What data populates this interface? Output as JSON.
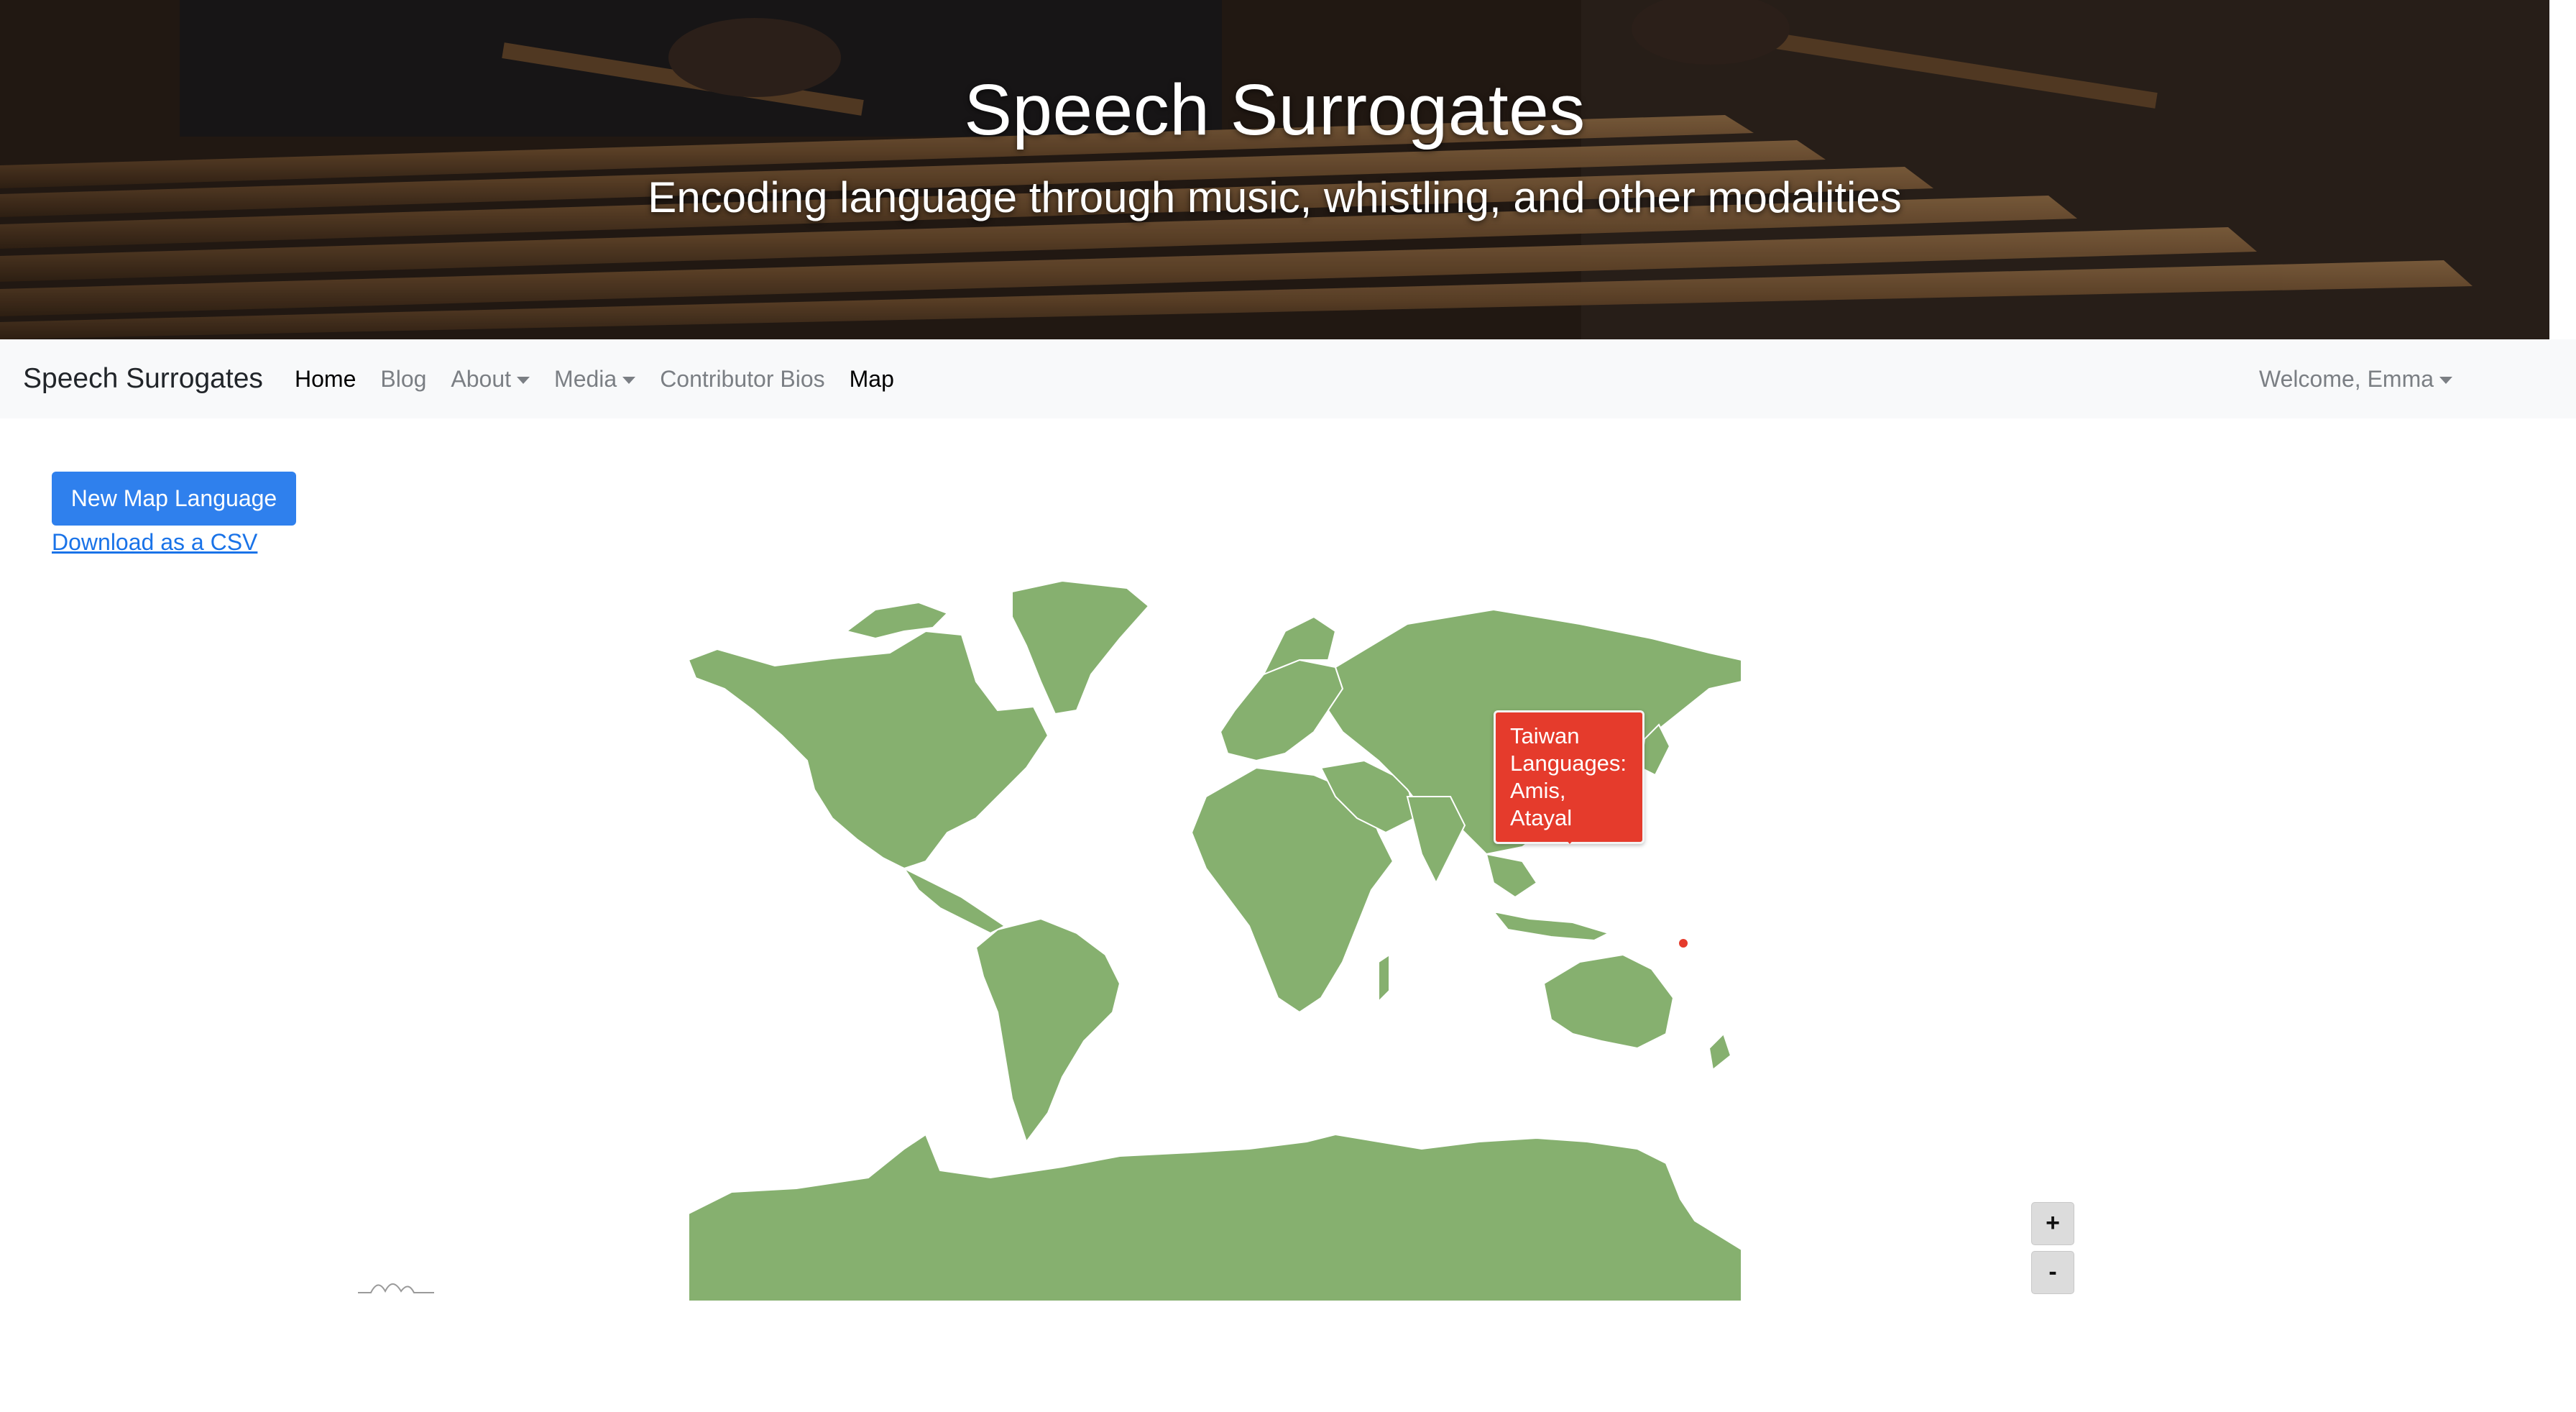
{
  "hero": {
    "title": "Speech Surrogates",
    "subtitle": "Encoding language through music, whistling, and other modalities"
  },
  "navbar": {
    "brand": "Speech Surrogates",
    "links": [
      {
        "label": "Home",
        "active": true
      },
      {
        "label": "Blog"
      },
      {
        "label": "About",
        "dropdown": true
      },
      {
        "label": "Media",
        "dropdown": true
      },
      {
        "label": "Contributor Bios"
      },
      {
        "label": "Map",
        "active": true
      }
    ],
    "user_menu": "Welcome, Emma"
  },
  "actions": {
    "new_button": "New Map Language",
    "csv_link": "Download as a CSV"
  },
  "map": {
    "land_color": "#86b06f",
    "border_color": "#ffffff",
    "marker_color": "#e53b2c",
    "tooltip": {
      "line1": "Taiwan",
      "line2": "Languages:",
      "line3": "Amis,",
      "line4": "Atayal"
    },
    "zoom_in": "+",
    "zoom_out": "-"
  },
  "icons": [
    "caret-down-icon",
    "wave-logo-icon"
  ]
}
